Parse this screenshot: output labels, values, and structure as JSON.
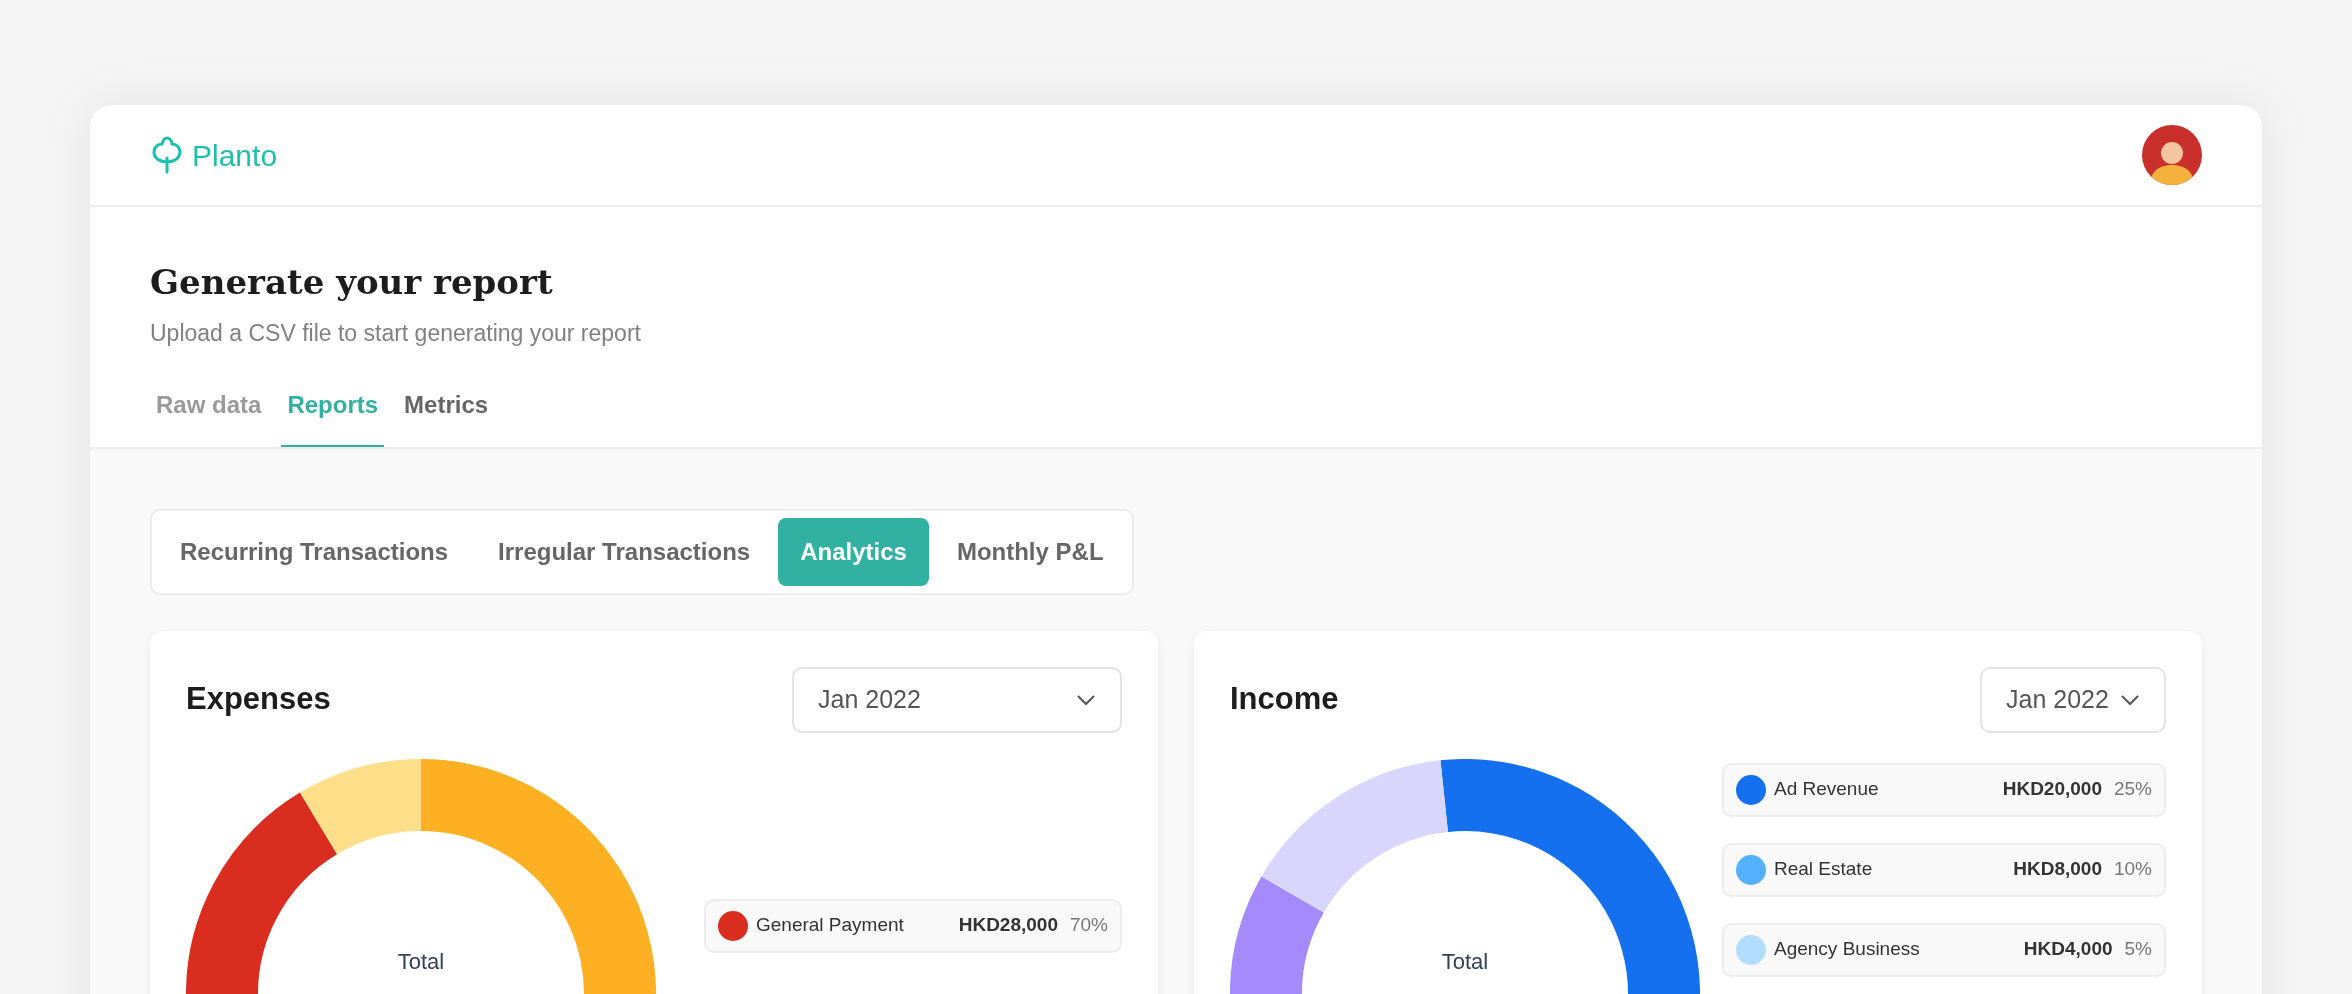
{
  "header": {
    "logo": "Planto"
  },
  "page": {
    "title": "Generate your report",
    "subtitle": "Upload a CSV file to start generating your report"
  },
  "tabs": [
    {
      "label": "Raw data",
      "selected": false
    },
    {
      "label": "Reports",
      "selected": true
    },
    {
      "label": "Metrics",
      "selected": false
    }
  ],
  "report_tabs": [
    {
      "label": "Recurring Transactions",
      "selected": false
    },
    {
      "label": "Irregular Transactions",
      "selected": false
    },
    {
      "label": "Analytics",
      "selected": true
    },
    {
      "label": "Monthly P&L",
      "selected": false
    }
  ],
  "cards": [
    {
      "kind": "expenses",
      "title": "Expenses",
      "period": "Jan 2022",
      "center_label": "Total",
      "legend": [
        {
          "name": "General Payment",
          "amount": "HKD28,000",
          "percent": "70%",
          "color": "#d92d20"
        }
      ]
    },
    {
      "kind": "income",
      "title": "Income",
      "period": "Jan 2022",
      "center_label": "Total",
      "legend": [
        {
          "name": "Ad Revenue",
          "amount": "HKD20,000",
          "percent": "25%",
          "color": "#1570ef"
        },
        {
          "name": "Real Estate",
          "amount": "HKD8,000",
          "percent": "10%",
          "color": "#53b1fd"
        },
        {
          "name": "Agency Business",
          "amount": "HKD4,000",
          "percent": "5%",
          "color": "#b2ddff"
        }
      ]
    }
  ]
}
